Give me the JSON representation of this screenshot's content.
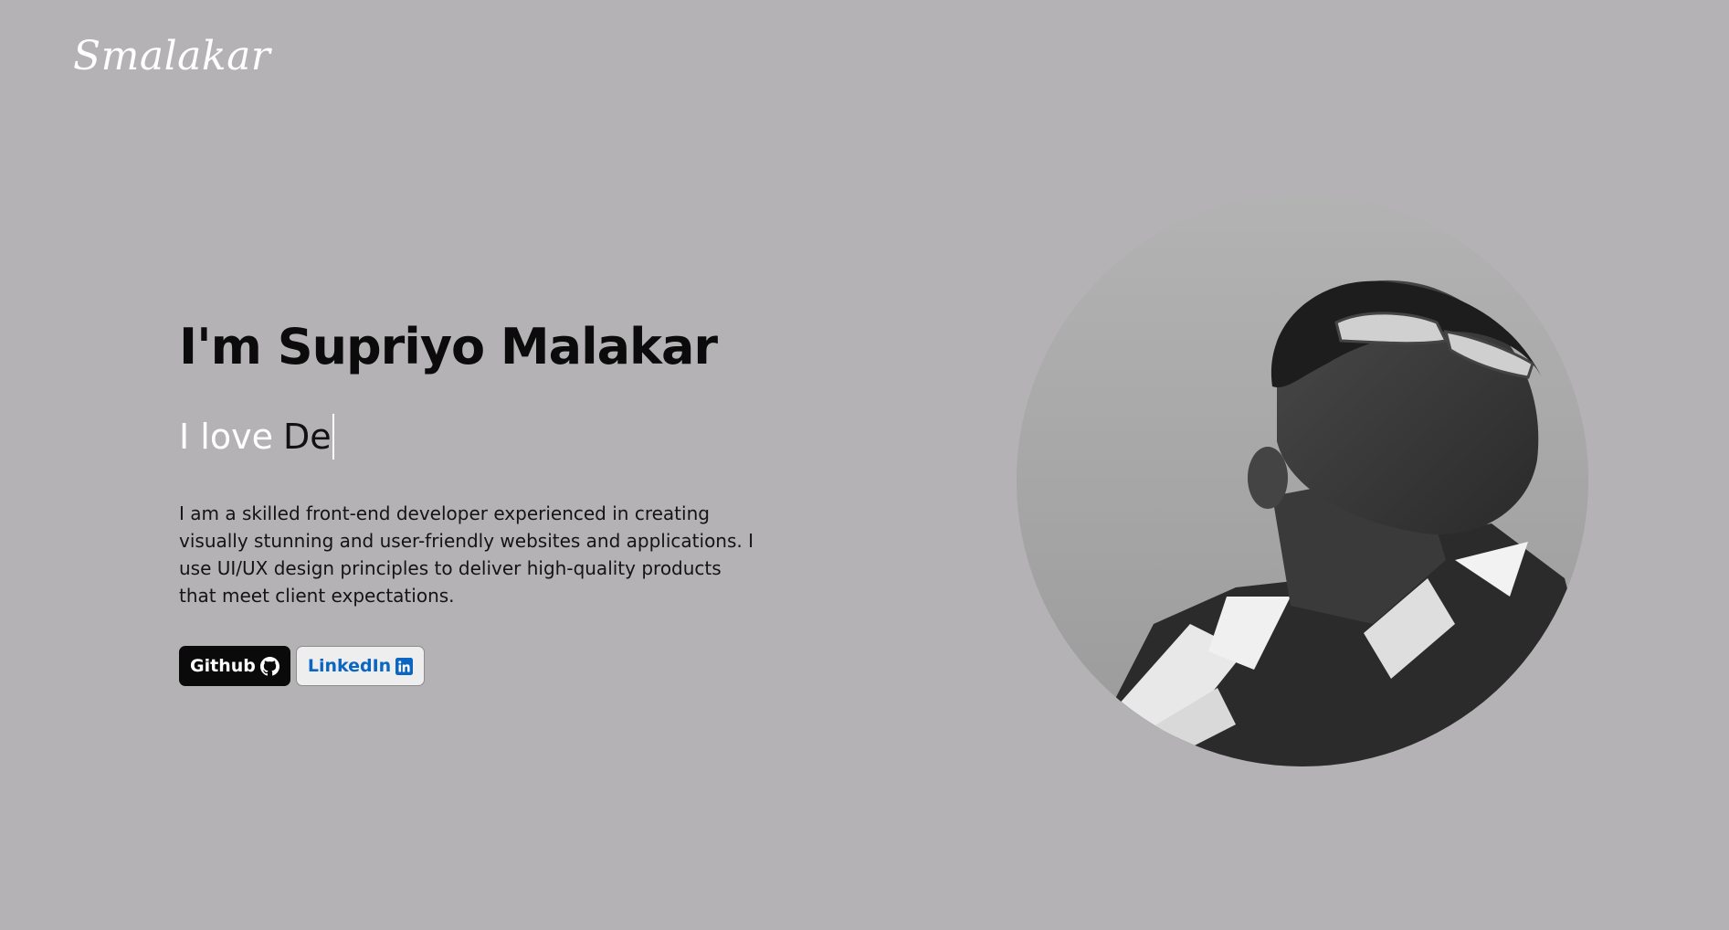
{
  "brand": {
    "logo_text": "Smalakar"
  },
  "hero": {
    "title": "I'm Supriyo Malakar",
    "love_prefix": "I love",
    "typed_text": "De",
    "description": "I am a skilled front-end developer experienced in creating visually stunning and user-friendly websites and applications. I use UI/UX design principles to deliver high-quality products that meet client expectations."
  },
  "buttons": {
    "github_label": "Github",
    "linkedin_label": "LinkedIn"
  },
  "icons": {
    "github": "github-icon",
    "linkedin": "linkedin-icon"
  },
  "colors": {
    "background": "#b4b2b5",
    "accent_white": "#ffffff",
    "github_button": "#0a0a0a",
    "linkedin_blue": "#0a66c2"
  }
}
